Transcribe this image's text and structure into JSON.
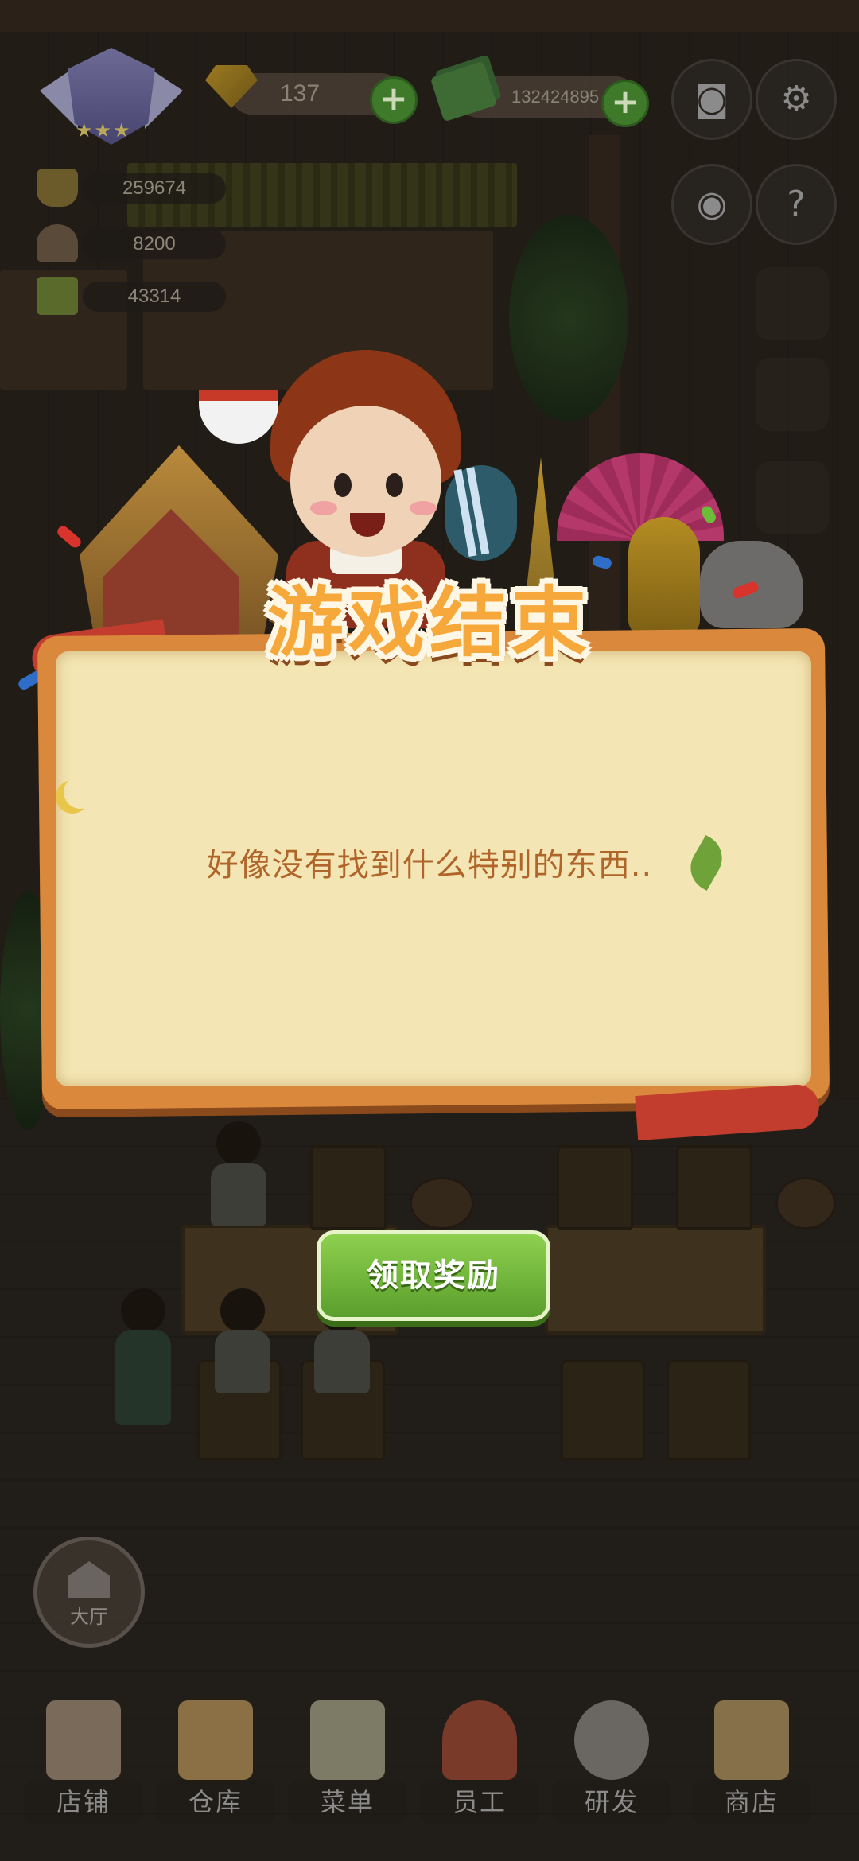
{
  "hud": {
    "gems": "137",
    "cash": "132424895",
    "stats": [
      "259674",
      "8200",
      "43314"
    ]
  },
  "dialog": {
    "title": "游戏结束",
    "message": "好像没有找到什么特别的东西..",
    "claim_button": "领取奖励"
  },
  "hall_button": "大厅",
  "nav": [
    {
      "label": "店铺",
      "icon": "shop-icon"
    },
    {
      "label": "仓库",
      "icon": "warehouse-icon"
    },
    {
      "label": "菜单",
      "icon": "menu-clipboard-icon"
    },
    {
      "label": "员工",
      "icon": "staff-icon"
    },
    {
      "label": "研发",
      "icon": "research-pot-icon"
    },
    {
      "label": "商店",
      "icon": "store-icon"
    }
  ],
  "colors": {
    "title": "#f6a83a",
    "message": "#b0652a",
    "claim_button": "#6fb43a",
    "panel_paper": "#f4e6b4"
  }
}
